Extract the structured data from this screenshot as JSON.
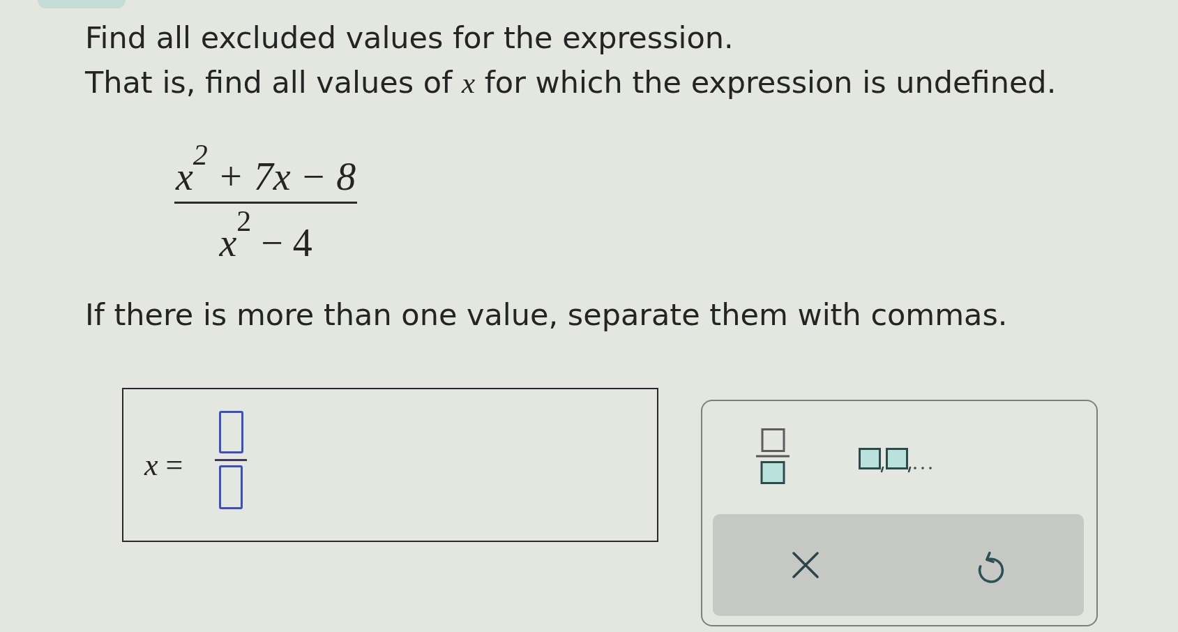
{
  "question": {
    "lines": [
      "Find all excluded values for the expression.",
      "That is, find all values of *x* for which the expression is undefined."
    ],
    "expression": {
      "numerator": "x$^{2}$ + 7x − 8",
      "denominator": "*x*$^{2}$ − 4"
    },
    "instruction": "If there is more than one value, separate them with commas."
  },
  "answer": {
    "label": "*x* =",
    "kind": "fraction"
  },
  "keypad": {
    "templates": [
      {
        "kind": "fraction"
      },
      {
        "kind": "list"
      }
    ],
    "actions": [
      {
        "kind": "clear"
      },
      {
        "kind": "undo"
      }
    ]
  }
}
